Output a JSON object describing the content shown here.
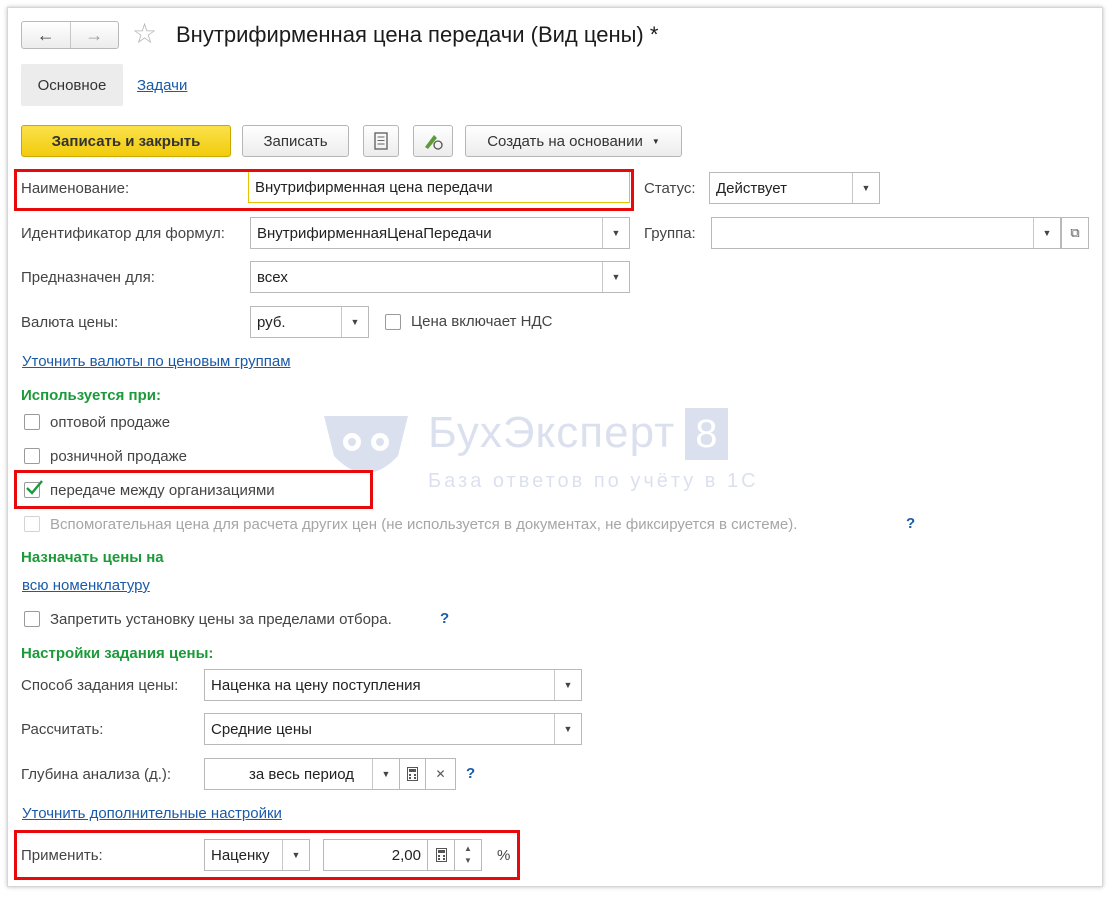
{
  "window": {
    "nav_back": "←",
    "nav_forward": "→",
    "title": "Внутрифирменная цена передачи (Вид цены) *"
  },
  "tabs": {
    "main": "Основное",
    "tasks": "Задачи"
  },
  "toolbar": {
    "save_close": "Записать и закрыть",
    "save": "Записать",
    "create_based": "Создать на основании"
  },
  "form": {
    "name_label": "Наименование:",
    "name_value": "Внутрифирменная цена передачи",
    "status_label": "Статус:",
    "status_value": "Действует",
    "id_label": "Идентификатор для формул:",
    "id_value": "ВнутрифирменнаяЦенаПередачи",
    "group_label": "Группа:",
    "group_value": "",
    "purpose_label": "Предназначен для:",
    "purpose_value": "всех",
    "currency_label": "Валюта цены:",
    "currency_value": "руб.",
    "vat_label": "Цена включает НДС",
    "clarify_currency_link": "Уточнить валюты по ценовым группам"
  },
  "used_in": {
    "heading": "Используется при:",
    "wholesale": "оптовой продаже",
    "retail": "розничной продаже",
    "transfer": "передаче между организациями",
    "auxiliary": "Вспомогательная цена для расчета других цен (не используется в документах, не фиксируется в системе).",
    "help": "?"
  },
  "assign": {
    "heading": "Назначать цены на",
    "link": "всю номенклатуру",
    "forbid_label": "Запретить установку цены за пределами отбора.",
    "help": "?"
  },
  "settings": {
    "heading": "Настройки задания цены:",
    "method_label": "Способ задания цены:",
    "method_value": "Наценка на цену поступления",
    "calc_label": "Рассчитать:",
    "calc_value": "Средние цены",
    "depth_label": "Глубина анализа (д.):",
    "depth_value": "за весь период",
    "depth_help": "?",
    "extra_link": "Уточнить дополнительные настройки",
    "apply_label": "Применить:",
    "apply_type": "Наценку",
    "apply_value": "2,00",
    "apply_unit": "%"
  },
  "watermark": {
    "brand": "БухЭксперт",
    "digit": "8",
    "tagline": "База ответов по учёту в 1С"
  },
  "colors": {
    "accent": "#f2cc0c",
    "link": "#1a5aa8",
    "section": "#1c9a3a",
    "highlight": "#e8090b"
  }
}
